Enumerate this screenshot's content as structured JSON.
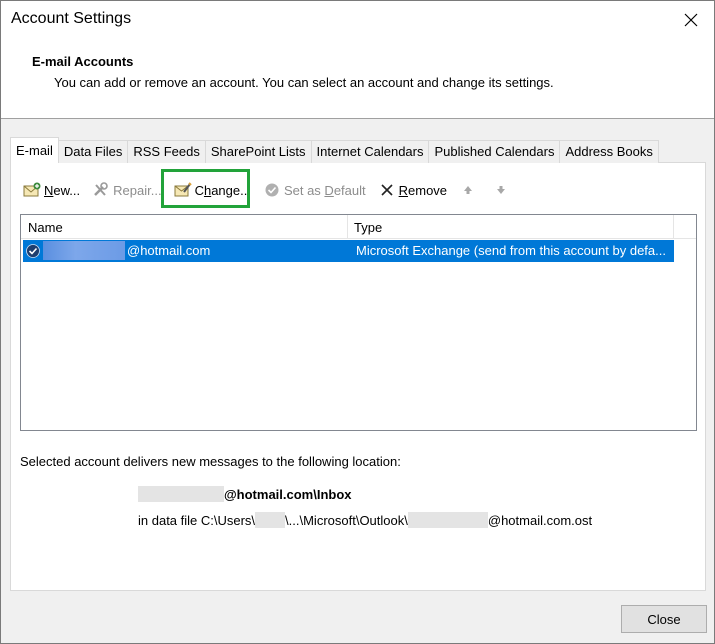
{
  "window": {
    "title": "Account Settings"
  },
  "header": {
    "title": "E-mail Accounts",
    "description": "You can add or remove an account. You can select an account and change its settings."
  },
  "tabs": [
    {
      "label": "E-mail",
      "active": true
    },
    {
      "label": "Data Files"
    },
    {
      "label": "RSS Feeds"
    },
    {
      "label": "SharePoint Lists"
    },
    {
      "label": "Internet Calendars"
    },
    {
      "label": "Published Calendars"
    },
    {
      "label": "Address Books"
    }
  ],
  "toolbar": {
    "new_pre": "N",
    "new_post": "ew...",
    "repair": "Repair...",
    "change_pre": "C",
    "change_mid": "h",
    "change_post": "ange...",
    "set_default_pre": "Set as ",
    "set_default_mid": "D",
    "set_default_post": "efault",
    "remove_pre": "R",
    "remove_mid": "e",
    "remove_post": "move"
  },
  "accounts_table": {
    "columns": [
      "Name",
      "Type"
    ],
    "rows": [
      {
        "name": "@hotmail.com",
        "type": "Microsoft Exchange (send from this account by defa..."
      }
    ]
  },
  "delivery": {
    "label": "Selected account delivers new messages to the following location:",
    "folder": "@hotmail.com\\Inbox",
    "data_file_prefix": "in data file C:\\Users\\",
    "data_file_middle": "\\...\\Microsoft\\Outlook\\",
    "data_file_suffix": "@hotmail.com.ost"
  },
  "footer": {
    "close_label": "Close"
  },
  "colors": {
    "selection": "#0078d7",
    "highlight_box": "#22a33a"
  }
}
